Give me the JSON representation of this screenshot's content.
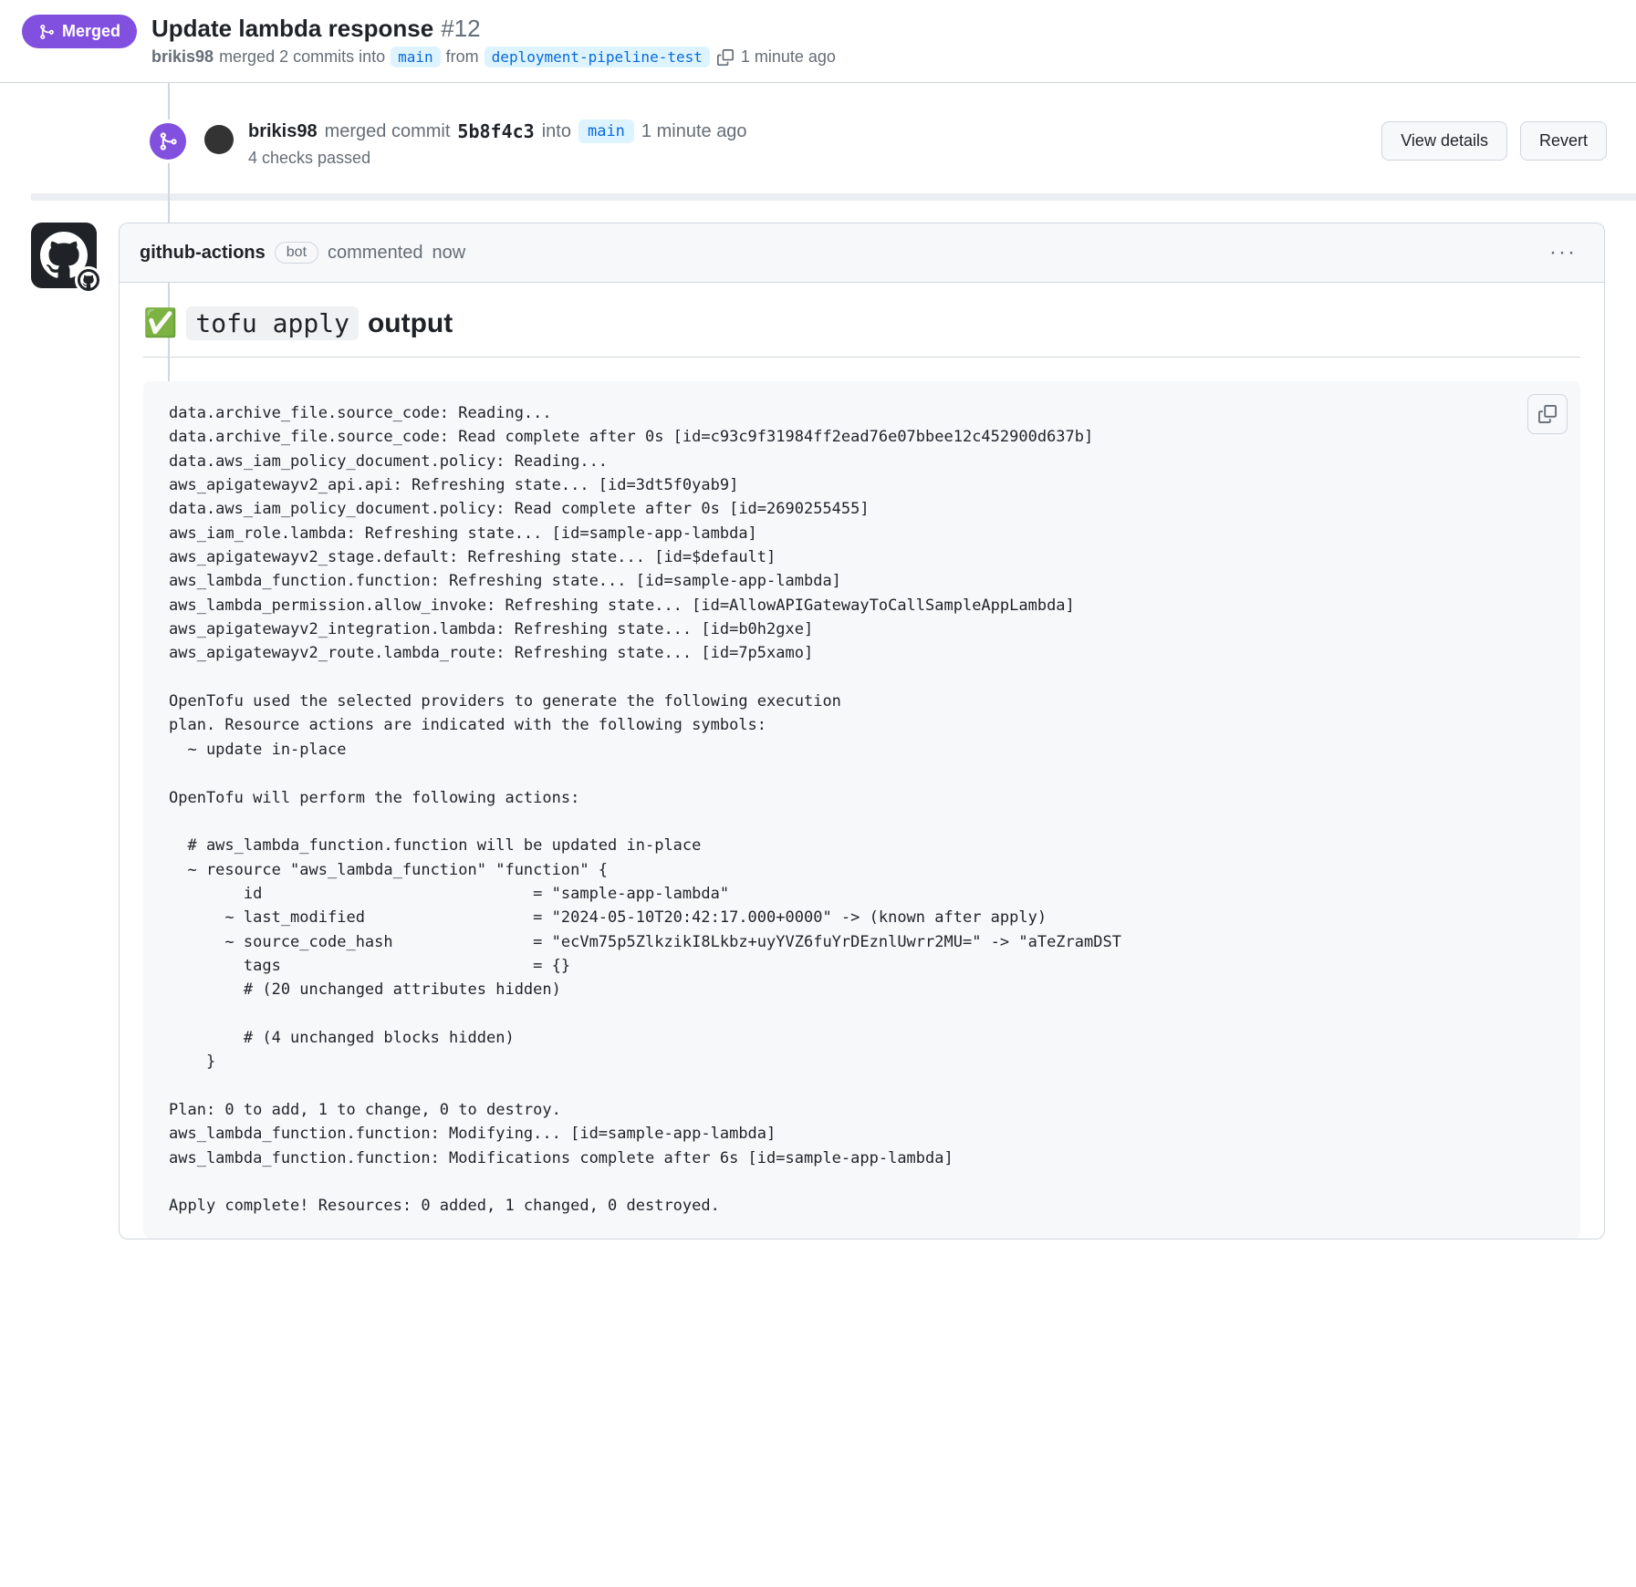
{
  "header": {
    "status_label": "Merged",
    "title": "Update lambda response",
    "number": "#12",
    "author": "brikis98",
    "merge_verb": "merged 2 commits into",
    "base_branch": "main",
    "from_label": "from",
    "head_branch": "deployment-pipeline-test",
    "time_ago": "1 minute ago"
  },
  "merge_event": {
    "author": "brikis98",
    "text1": "merged commit",
    "commit_sha": "5b8f4c3",
    "text2": "into",
    "branch": "main",
    "time_ago": "1 minute ago",
    "checks": "4 checks passed",
    "view_details_label": "View details",
    "revert_label": "Revert"
  },
  "comment": {
    "author": "github-actions",
    "bot_label": "bot",
    "verb": "commented",
    "time": "now",
    "title_emoji": "✅",
    "title_code": "tofu apply",
    "title_suffix": "output",
    "code_output": "data.archive_file.source_code: Reading...\ndata.archive_file.source_code: Read complete after 0s [id=c93c9f31984ff2ead76e07bbee12c452900d637b]\ndata.aws_iam_policy_document.policy: Reading...\naws_apigatewayv2_api.api: Refreshing state... [id=3dt5f0yab9]\ndata.aws_iam_policy_document.policy: Read complete after 0s [id=2690255455]\naws_iam_role.lambda: Refreshing state... [id=sample-app-lambda]\naws_apigatewayv2_stage.default: Refreshing state... [id=$default]\naws_lambda_function.function: Refreshing state... [id=sample-app-lambda]\naws_lambda_permission.allow_invoke: Refreshing state... [id=AllowAPIGatewayToCallSampleAppLambda]\naws_apigatewayv2_integration.lambda: Refreshing state... [id=b0h2gxe]\naws_apigatewayv2_route.lambda_route: Refreshing state... [id=7p5xamo]\n\nOpenTofu used the selected providers to generate the following execution\nplan. Resource actions are indicated with the following symbols:\n  ~ update in-place\n\nOpenTofu will perform the following actions:\n\n  # aws_lambda_function.function will be updated in-place\n  ~ resource \"aws_lambda_function\" \"function\" {\n        id                             = \"sample-app-lambda\"\n      ~ last_modified                  = \"2024-05-10T20:42:17.000+0000\" -> (known after apply)\n      ~ source_code_hash               = \"ecVm75p5ZlkzikI8Lkbz+uyYVZ6fuYrDEznlUwrr2MU=\" -> \"aTeZramDST\n        tags                           = {}\n        # (20 unchanged attributes hidden)\n\n        # (4 unchanged blocks hidden)\n    }\n\nPlan: 0 to add, 1 to change, 0 to destroy.\naws_lambda_function.function: Modifying... [id=sample-app-lambda]\naws_lambda_function.function: Modifications complete after 6s [id=sample-app-lambda]\n\nApply complete! Resources: 0 added, 1 changed, 0 destroyed."
  }
}
